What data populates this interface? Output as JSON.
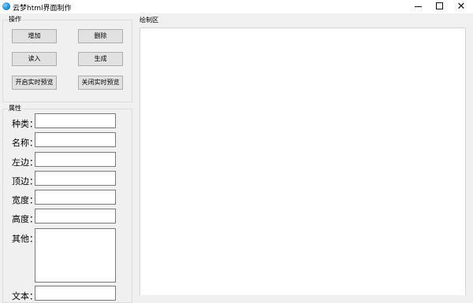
{
  "window": {
    "title": "云梦html界面制作",
    "minimize_icon": "minimize-icon",
    "maximize_icon": "maximize-icon",
    "close_label": "✕"
  },
  "operations": {
    "label": "操作",
    "add": "增加",
    "delete": "删除",
    "read": "读入",
    "generate": "生成",
    "open_preview": "开启实时预览",
    "close_preview": "关闭实时预览"
  },
  "properties": {
    "label": "属性",
    "fields": [
      {
        "label": "种类：",
        "value": ""
      },
      {
        "label": "名称：",
        "value": ""
      },
      {
        "label": "左边：",
        "value": ""
      },
      {
        "label": "顶边：",
        "value": ""
      },
      {
        "label": "宽度：",
        "value": ""
      },
      {
        "label": "高度：",
        "value": ""
      },
      {
        "label": "其他：",
        "value": ""
      },
      {
        "label": "文本：",
        "value": ""
      }
    ]
  },
  "drawing": {
    "label": "绘制区"
  }
}
